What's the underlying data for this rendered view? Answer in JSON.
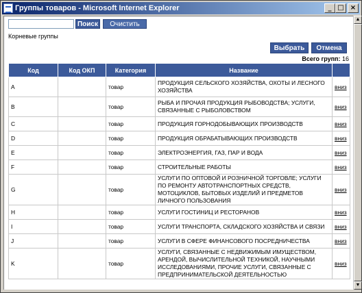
{
  "window": {
    "title": "Группы товаров - Microsoft Internet Explorer",
    "minimize": "_",
    "maximize": "□",
    "close": "×"
  },
  "search": {
    "value": "",
    "placeholder": "",
    "search_label": "Поиск",
    "clear_label": "Очистить"
  },
  "root_groups": "Корневые группы",
  "actions": {
    "select_label": "Выбрать",
    "cancel_label": "Отмена"
  },
  "total": {
    "label": "Всего групп:",
    "count": "16"
  },
  "table": {
    "headers": [
      "Код",
      "Код ОКП",
      "Категория",
      "Название",
      ""
    ],
    "rows": [
      {
        "code": "A",
        "okp": "",
        "category": "товар",
        "name": "ПРОДУКЦИЯ СЕЛЬСКОГО ХОЗЯЙСТВА, ОХОТЫ И ЛЕСНОГО ХОЗЯЙСТВА",
        "link": "вниз"
      },
      {
        "code": "B",
        "okp": "",
        "category": "товар",
        "name": "РЫБА И ПРОЧАЯ ПРОДУКЦИЯ РЫБОВОДСТВА; УСЛУГИ, СВЯЗАННЫЕ С РЫБОЛОВСТВОМ",
        "link": "вниз"
      },
      {
        "code": "C",
        "okp": "",
        "category": "товар",
        "name": "ПРОДУКЦИЯ ГОРНОДОБЫВАЮЩИХ ПРОИЗВОДСТВ",
        "link": "вниз"
      },
      {
        "code": "D",
        "okp": "",
        "category": "товар",
        "name": "ПРОДУКЦИЯ ОБРАБАТЫВАЮЩИХ ПРОИЗВОДСТВ",
        "link": "вниз"
      },
      {
        "code": "E",
        "okp": "",
        "category": "товар",
        "name": "ЭЛЕКТРОЭНЕРГИЯ, ГАЗ, ПАР И ВОДА",
        "link": "вниз"
      },
      {
        "code": "F",
        "okp": "",
        "category": "товар",
        "name": "СТРОИТЕЛЬНЫЕ РАБОТЫ",
        "link": "вниз"
      },
      {
        "code": "G",
        "okp": "",
        "category": "товар",
        "name": "УСЛУГИ ПО ОПТОВОЙ И РОЗНИЧНОЙ ТОРГОВЛЕ; УСЛУГИ ПО РЕМОНТУ АВТОТРАНСПОРТНЫХ СРЕДСТВ, МОТОЦИКЛОВ, БЫТОВЫХ ИЗДЕЛИЙ И ПРЕДМЕТОВ ЛИЧНОГО ПОЛЬЗОВАНИЯ",
        "link": "вниз"
      },
      {
        "code": "H",
        "okp": "",
        "category": "товар",
        "name": "УСЛУГИ ГОСТИНИЦ И РЕСТОРАНОВ",
        "link": "вниз"
      },
      {
        "code": "I",
        "okp": "",
        "category": "товар",
        "name": "УСЛУГИ ТРАНСПОРТА, СКЛАДСКОГО ХОЗЯЙСТВА И СВЯЗИ",
        "link": "вниз"
      },
      {
        "code": "J",
        "okp": "",
        "category": "товар",
        "name": "УСЛУГИ В СФЕРЕ ФИНАНСОВОГО ПОСРЕДНИЧЕСТВА",
        "link": "вниз"
      },
      {
        "code": "K",
        "okp": "",
        "category": "товар",
        "name": "УСЛУГИ, СВЯЗАННЫЕ С НЕДВИЖИМЫМ ИМУЩЕСТВОМ, АРЕНДОЙ, ВЫЧИСЛИТЕЛЬНОЙ ТЕХНИКОЙ, НАУЧНЫМИ ИССЛЕДОВАНИЯМИ, ПРОЧИЕ УСЛУГИ, СВЯЗАННЫЕ С ПРЕДПРИНИМАТЕЛЬСКОЙ ДЕЯТЕЛЬНОСТЬЮ",
        "link": "вниз"
      }
    ]
  }
}
